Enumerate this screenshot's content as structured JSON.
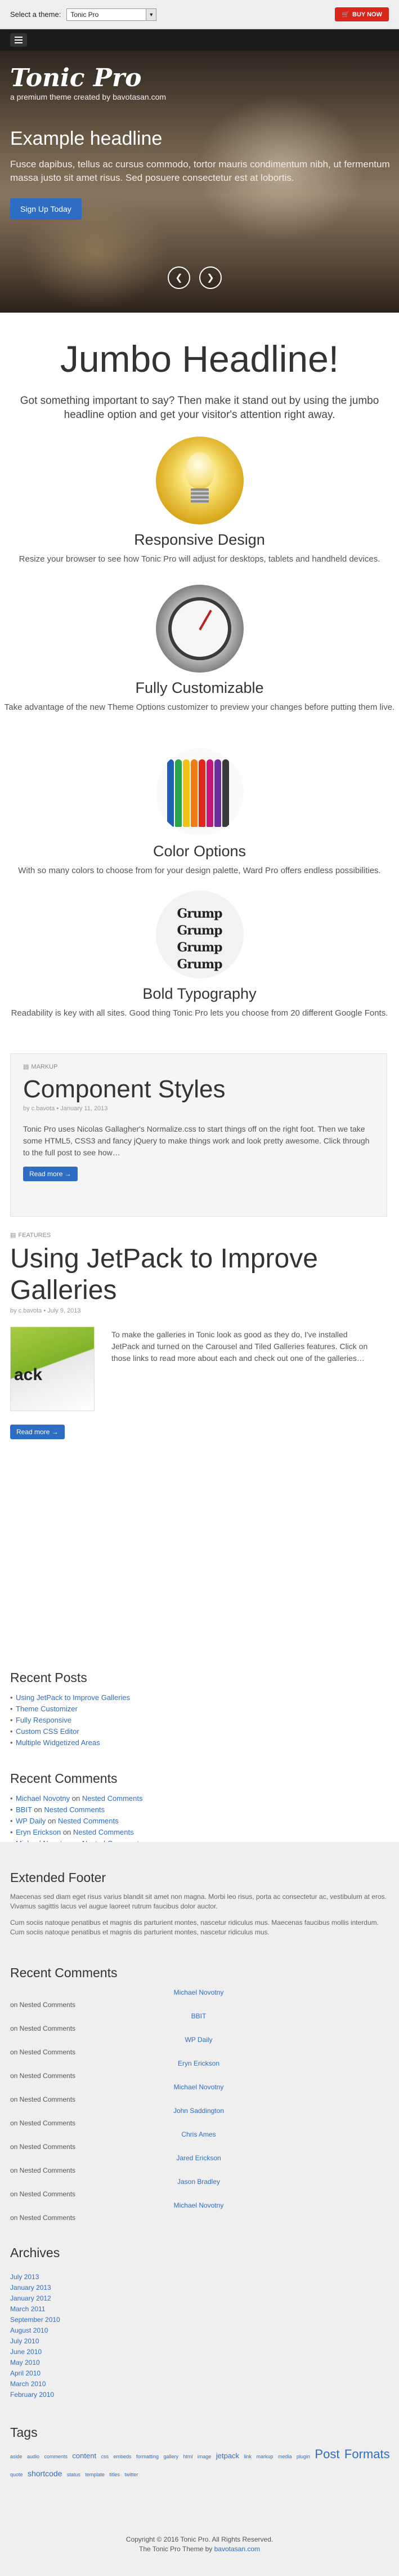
{
  "theme_bar": {
    "label": "Select a theme:",
    "selected_theme": "Tonic Pro",
    "buy_label": "BUY NOW"
  },
  "hero": {
    "brand_name": "Tonic Pro",
    "brand_tagline": "a premium theme created by bavotasan.com",
    "headline": "Example headline",
    "text": "Fusce dapibus, tellus ac cursus commodo, tortor mauris condimentum nibh, ut fermentum massa justo sit amet risus. Sed posuere consectetur est at lobortis.",
    "button_label": "Sign Up Today",
    "prev_icon": "chevron-left-icon",
    "next_icon": "chevron-right-icon"
  },
  "jumbo": {
    "headline": "Jumbo Headline!",
    "text": "Got something important to say? Then make it stand out by using the jumbo headline option and get your visitor's attention right away."
  },
  "features": [
    {
      "title": "Responsive Design",
      "text": "Resize your browser to see how Tonic Pro will adjust for desktops, tablets and handheld devices."
    },
    {
      "title": "Fully Customizable",
      "text": "Take advantage of the new Theme Options customizer to preview your changes before putting them live."
    },
    {
      "title": "Color Options",
      "text": "With so many colors to choose from for your design palette, Ward Pro offers endless possibilities."
    },
    {
      "title": "Bold Typography",
      "text": "Readability is key with all sites. Good thing Tonic Pro lets you choose from 20 different Google Fonts."
    }
  ],
  "typography_image_text": [
    "Grump",
    "Grump",
    "Grump",
    "Grump"
  ],
  "post1": {
    "category": "MARKUP",
    "title": "Component Styles",
    "meta": "by c.bavota • January 11, 2013",
    "excerpt": "Tonic Pro uses Nicolas Gallagher's Normalize.css to start things off on the right foot. Then we take some HTML5, CSS3 and fancy jQuery to make things work and look pretty awesome. Click through to the full post to see how…",
    "read_more": "Read more →"
  },
  "post2": {
    "category": "FEATURES",
    "title": "Using JetPack to Improve Galleries",
    "meta": "by c.bavota • July 9, 2013",
    "thumb_text": "ack",
    "excerpt": "To make the galleries in Tonic look as good as they do, I've installed JetPack and turned on the Carousel and Tiled Galleries features. Click on those links to read more about each and check out one of the galleries…",
    "read_more": "Read more →"
  },
  "recent_posts": {
    "title": "Recent Posts",
    "items": [
      "Using JetPack to Improve Galleries",
      "Theme Customizer",
      "Fully Responsive",
      "Custom CSS Editor",
      "Multiple Widgetized Areas"
    ]
  },
  "recent_comments": {
    "title": "Recent Comments",
    "items": [
      {
        "author": "Michael Novotny",
        "on": "on",
        "post": "Nested Comments"
      },
      {
        "author": "BBIT",
        "on": "on",
        "post": "Nested Comments"
      },
      {
        "author": "WP Daily",
        "on": "on",
        "post": "Nested Comments"
      },
      {
        "author": "Eryn Erickson",
        "on": "on",
        "post": "Nested Comments"
      },
      {
        "author": "Michael Novotny",
        "on": "on",
        "post": "Nested Comments"
      }
    ]
  },
  "extended_footer": {
    "title": "Extended Footer",
    "text1": "Maecenas sed diam eget risus varius blandit sit amet non magna. Morbi leo risus, porta ac consectetur ac, vestibulum at eros. Vivamus sagittis lacus vel augue laoreet rutrum faucibus dolor auctor.",
    "text2": "Cum sociis natoque penatibus et magnis dis parturient montes, nascetur ridiculus mus. Maecenas faucibus mollis interdum. Cum sociis natoque penatibus et magnis dis parturient montes, nascetur ridiculus mus."
  },
  "footer_comments": {
    "title": "Recent Comments",
    "items": [
      {
        "author": "Michael Novotny",
        "text": "on Nested Comments"
      },
      {
        "author": "BBIT",
        "text": "on Nested Comments"
      },
      {
        "author": "WP Daily",
        "text": "on Nested Comments"
      },
      {
        "author": "Eryn Erickson",
        "text": "on Nested Comments"
      },
      {
        "author": "Michael Novotny",
        "text": "on Nested Comments"
      },
      {
        "author": "John Saddington",
        "text": "on Nested Comments"
      },
      {
        "author": "Chris Ames",
        "text": "on Nested Comments"
      },
      {
        "author": "Jared Erickson",
        "text": "on Nested Comments"
      },
      {
        "author": "Jason Bradley",
        "text": "on Nested Comments"
      },
      {
        "author": "Michael Novotny",
        "text": "on Nested Comments"
      }
    ]
  },
  "archives": {
    "title": "Archives",
    "items": [
      "July 2013",
      "January 2013",
      "January 2012",
      "March 2011",
      "September 2010",
      "August 2010",
      "July 2010",
      "June 2010",
      "May 2010",
      "April 2010",
      "March 2010",
      "February 2010"
    ]
  },
  "tags": {
    "title": "Tags",
    "items": [
      {
        "label": "aside",
        "size": 9
      },
      {
        "label": "audio",
        "size": 9
      },
      {
        "label": "comments",
        "size": 9
      },
      {
        "label": "content",
        "size": 13
      },
      {
        "label": "css",
        "size": 9
      },
      {
        "label": "embeds",
        "size": 9
      },
      {
        "label": "formatting",
        "size": 9
      },
      {
        "label": "gallery",
        "size": 9
      },
      {
        "label": "html",
        "size": 9
      },
      {
        "label": "image",
        "size": 9
      },
      {
        "label": "jetpack",
        "size": 13
      },
      {
        "label": "link",
        "size": 9
      },
      {
        "label": "markup",
        "size": 9
      },
      {
        "label": "media",
        "size": 9
      },
      {
        "label": "plugin",
        "size": 9
      },
      {
        "label": "Post",
        "size": 22
      },
      {
        "label": "Formats",
        "size": 22
      },
      {
        "label": "quote",
        "size": 9
      },
      {
        "label": "shortcode",
        "size": 14
      },
      {
        "label": "status",
        "size": 9
      },
      {
        "label": "template",
        "size": 9
      },
      {
        "label": "titles",
        "size": 9
      },
      {
        "label": "twitter",
        "size": 9
      }
    ]
  },
  "copyright": {
    "line1": "Copyright © 2016 Tonic Pro. All Rights Reserved.",
    "line2_prefix": "The Tonic Pro Theme by",
    "line2_link": "bavotasan.com"
  },
  "colors": {
    "accent_blue": "#2d6dc3",
    "buy_red": "#d9261c",
    "nav_dark": "#1b1b1b"
  }
}
